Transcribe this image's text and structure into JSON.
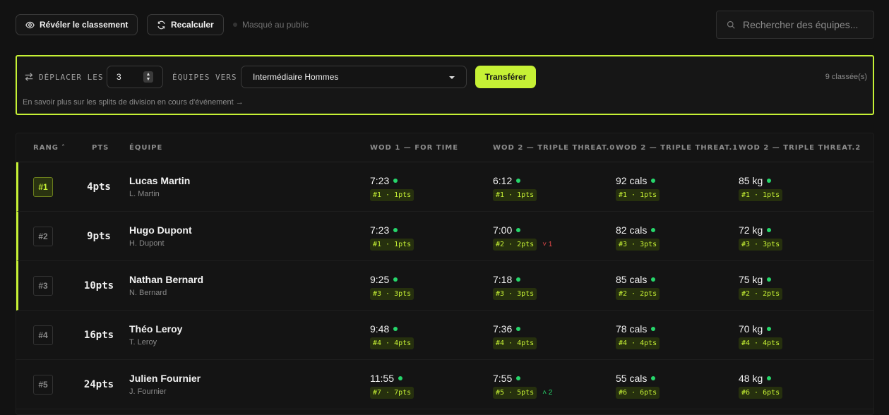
{
  "toolbar": {
    "reveal_label": "Révéler le classement",
    "recalc_label": "Recalculer",
    "status_label": "Masqué au public",
    "search_placeholder": "Rechercher des équipes..."
  },
  "transfer": {
    "move_label": "DÉPLACER LES",
    "count_value": "3",
    "teams_to_label": "ÉQUIPES VERS",
    "division_selected": "Intermédiaire Hommes",
    "transfer_button": "Transférer",
    "ranked_count": "9 classée(s)",
    "learn_more": "En savoir plus sur les splits de division en cours d'événement →"
  },
  "table": {
    "headers": {
      "rank": "RANG",
      "pts": "PTS",
      "team": "ÉQUIPE",
      "wod1": "WOD 1 — FOR TIME",
      "wod2a": "WOD 2 — TRIPLE THREAT.0",
      "wod2b": "WOD 2 — TRIPLE THREAT.1",
      "wod2c": "WOD 2 — TRIPLE THREAT.2"
    },
    "rows": [
      {
        "rank": "#1",
        "pts": "4pts",
        "name": "Lucas Martin",
        "short": "L. Martin",
        "scores": [
          {
            "value": "7:23",
            "chip": "#1 · 1pts",
            "delta": ""
          },
          {
            "value": "6:12",
            "chip": "#1 · 1pts",
            "delta": ""
          },
          {
            "value": "92 cals",
            "chip": "#1 · 1pts",
            "delta": ""
          },
          {
            "value": "85 kg",
            "chip": "#1 · 1pts",
            "delta": ""
          }
        ]
      },
      {
        "rank": "#2",
        "pts": "9pts",
        "name": "Hugo Dupont",
        "short": "H. Dupont",
        "scores": [
          {
            "value": "7:23",
            "chip": "#1 · 1pts",
            "delta": ""
          },
          {
            "value": "7:00",
            "chip": "#2 · 2pts",
            "delta": "˅ 1"
          },
          {
            "value": "82 cals",
            "chip": "#3 · 3pts",
            "delta": ""
          },
          {
            "value": "72 kg",
            "chip": "#3 · 3pts",
            "delta": ""
          }
        ]
      },
      {
        "rank": "#3",
        "pts": "10pts",
        "name": "Nathan Bernard",
        "short": "N. Bernard",
        "scores": [
          {
            "value": "9:25",
            "chip": "#3 · 3pts",
            "delta": ""
          },
          {
            "value": "7:18",
            "chip": "#3 · 3pts",
            "delta": ""
          },
          {
            "value": "85 cals",
            "chip": "#2 · 2pts",
            "delta": ""
          },
          {
            "value": "75 kg",
            "chip": "#2 · 2pts",
            "delta": ""
          }
        ]
      },
      {
        "rank": "#4",
        "pts": "16pts",
        "name": "Théo Leroy",
        "short": "T. Leroy",
        "scores": [
          {
            "value": "9:48",
            "chip": "#4 · 4pts",
            "delta": ""
          },
          {
            "value": "7:36",
            "chip": "#4 · 4pts",
            "delta": ""
          },
          {
            "value": "78 cals",
            "chip": "#4 · 4pts",
            "delta": ""
          },
          {
            "value": "70 kg",
            "chip": "#4 · 4pts",
            "delta": ""
          }
        ]
      },
      {
        "rank": "#5",
        "pts": "24pts",
        "name": "Julien Fournier",
        "short": "J. Fournier",
        "scores": [
          {
            "value": "11:55",
            "chip": "#7 · 7pts",
            "delta": ""
          },
          {
            "value": "7:55",
            "chip": "#5 · 5pts",
            "delta": "˄ 2"
          },
          {
            "value": "55 cals",
            "chip": "#6 · 6pts",
            "delta": ""
          },
          {
            "value": "48 kg",
            "chip": "#6 · 6pts",
            "delta": ""
          }
        ]
      }
    ]
  },
  "colors": {
    "accent": "#c6f135",
    "positive": "#26d66b",
    "negative": "#e04848"
  }
}
